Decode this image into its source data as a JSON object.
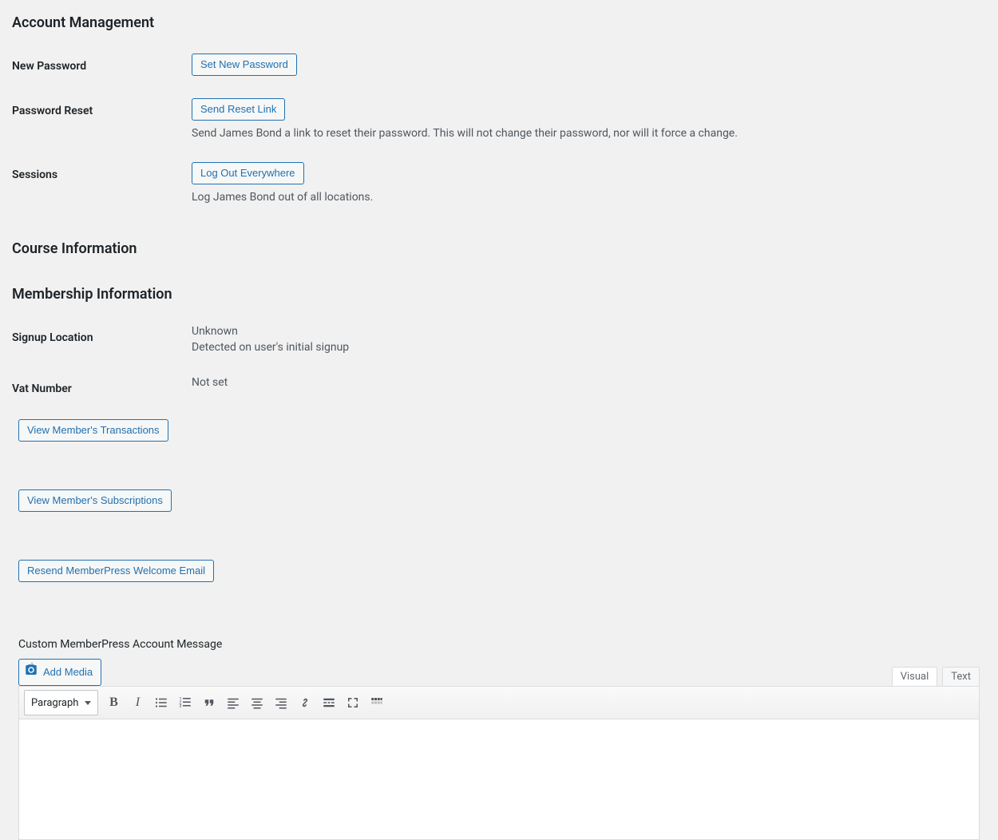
{
  "sections": {
    "account_heading": "Account Management",
    "course_heading": "Course Information",
    "membership_heading": "Membership Information"
  },
  "account": {
    "new_password": {
      "label": "New Password",
      "button": "Set New Password"
    },
    "password_reset": {
      "label": "Password Reset",
      "button": "Send Reset Link",
      "description": "Send James Bond a link to reset their password. This will not change their password, nor will it force a change."
    },
    "sessions": {
      "label": "Sessions",
      "button": "Log Out Everywhere",
      "description": "Log James Bond out of all locations."
    }
  },
  "membership": {
    "signup_location": {
      "label": "Signup Location",
      "value": "Unknown",
      "description": "Detected on user's initial signup"
    },
    "vat_number": {
      "label": "Vat Number",
      "value": "Not set"
    },
    "buttons": {
      "transactions": "View Member's Transactions",
      "subscriptions": "View Member's Subscriptions",
      "resend_welcome": "Resend MemberPress Welcome Email"
    },
    "custom_message_heading": "Custom MemberPress Account Message"
  },
  "editor": {
    "add_media": "Add Media",
    "format_selected": "Paragraph",
    "tabs": {
      "visual": "Visual",
      "text": "Text"
    },
    "content": ""
  }
}
